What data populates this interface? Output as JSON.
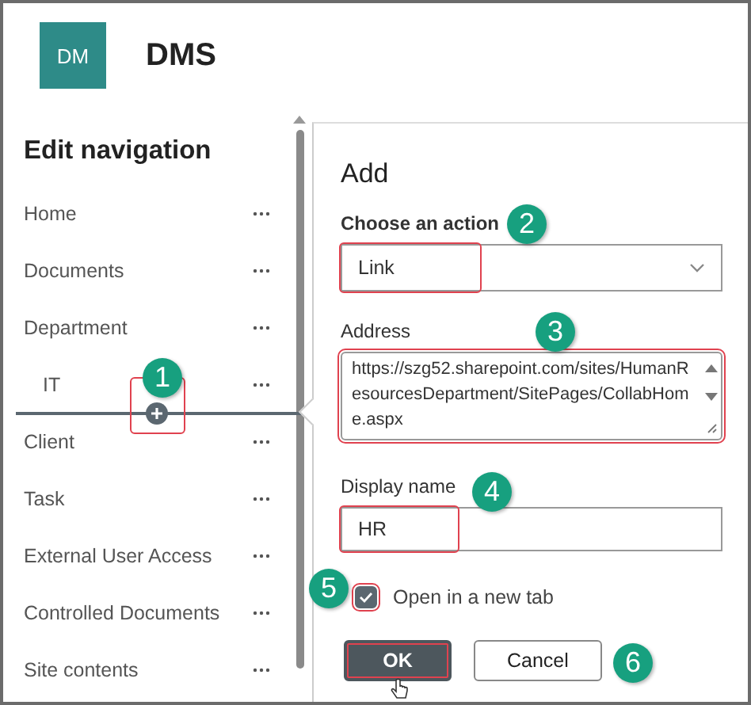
{
  "header": {
    "logo_initials": "DM",
    "site_title": "DMS"
  },
  "navigation": {
    "title": "Edit navigation",
    "items": [
      {
        "label": "Home"
      },
      {
        "label": "Documents"
      },
      {
        "label": "Department",
        "children": [
          {
            "label": "IT"
          }
        ]
      },
      {
        "label": "Client"
      },
      {
        "label": "Task"
      },
      {
        "label": "External User Access"
      },
      {
        "label": "Controlled Documents"
      },
      {
        "label": "Site contents"
      }
    ]
  },
  "dialog": {
    "title": "Add",
    "action": {
      "label": "Choose an action",
      "value": "Link"
    },
    "address": {
      "label": "Address",
      "value": "https://szg52.sharepoint.com/sites/HumanResourcesDepartment/SitePages/CollabHome.aspx"
    },
    "display_name": {
      "label": "Display name",
      "value": "HR"
    },
    "new_tab": {
      "label": "Open in a new tab",
      "checked": true
    },
    "buttons": [
      {
        "label": "OK",
        "kind": "primary"
      },
      {
        "label": "Cancel",
        "kind": "secondary"
      }
    ]
  },
  "callouts": [
    {
      "number": "1"
    },
    {
      "number": "2"
    },
    {
      "number": "3"
    },
    {
      "number": "4"
    },
    {
      "number": "5"
    },
    {
      "number": "6"
    }
  ]
}
